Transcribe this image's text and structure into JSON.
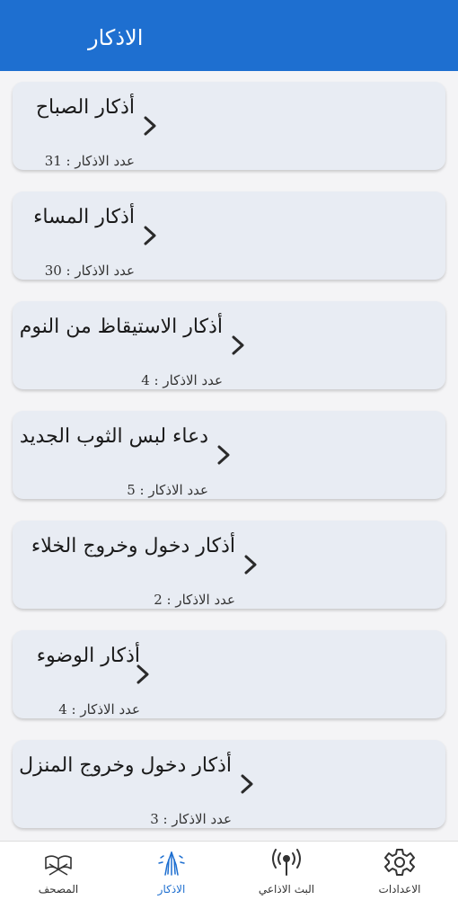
{
  "app_bar": {
    "title": "الاذكار"
  },
  "items": [
    {
      "title": "أذكار الصباح",
      "count": "عدد الاذكار : 31"
    },
    {
      "title": "أذكار المساء",
      "count": "عدد الاذكار : 30"
    },
    {
      "title": "أذكار الاستيقاظ من النوم",
      "count": "عدد الاذكار : 4"
    },
    {
      "title": "دعاء لبس الثوب الجديد",
      "count": "عدد الاذكار : 5"
    },
    {
      "title": "أذكار دخول وخروج الخلاء",
      "count": "عدد الاذكار : 2"
    },
    {
      "title": "أذكار الوضوء",
      "count": "عدد الاذكار : 4"
    },
    {
      "title": "أذكار دخول وخروج المنزل",
      "count": "عدد الاذكار : 3"
    }
  ],
  "bottom_nav": {
    "settings": "الاعدادات",
    "radio": "البث الاذاعي",
    "azkar": "الاذكار",
    "mushaf": "المصحف"
  },
  "colors": {
    "primary": "#1e6fd0",
    "card": "#e8ecf3",
    "active_nav": "#1e6fd0"
  }
}
